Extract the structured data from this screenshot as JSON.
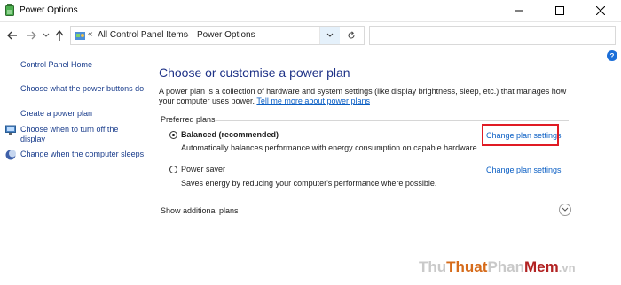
{
  "window": {
    "title": "Power Options"
  },
  "address": {
    "separator": "«",
    "crumbs": [
      "All Control Panel Items",
      "Power Options"
    ],
    "crumb_arrow": "›",
    "search_placeholder": ""
  },
  "sidebar": {
    "home": "Control Panel Home",
    "items": [
      {
        "label": "Choose what the power buttons do",
        "icon": "none"
      },
      {
        "label": "Create a power plan",
        "icon": "none"
      },
      {
        "label": "Choose when to turn off the display",
        "icon": "monitor-icon"
      },
      {
        "label": "Change when the computer sleeps",
        "icon": "moon-icon"
      }
    ]
  },
  "main": {
    "title": "Choose or customise a power plan",
    "description": "A power plan is a collection of hardware and system settings (like display brightness, sleep, etc.) that manages how your computer uses power.",
    "description_link": "Tell me more about power plans",
    "group_label": "Preferred plans",
    "plans": [
      {
        "name": "Balanced (recommended)",
        "desc": "Automatically balances performance with energy consumption on capable hardware.",
        "link": "Change plan settings",
        "selected": true
      },
      {
        "name": "Power saver",
        "desc": "Saves energy by reducing your computer's performance where possible.",
        "link": "Change plan settings",
        "selected": false
      }
    ],
    "show_more": "Show additional plans"
  },
  "watermark": {
    "part1": "Thu",
    "part2": "Thuat",
    "part3": "Phan",
    "part4": "Mem",
    "part5": ".vn"
  },
  "colors": {
    "title": "#1e3287",
    "link": "#0b5fc4",
    "highlight": "#e01b24"
  }
}
